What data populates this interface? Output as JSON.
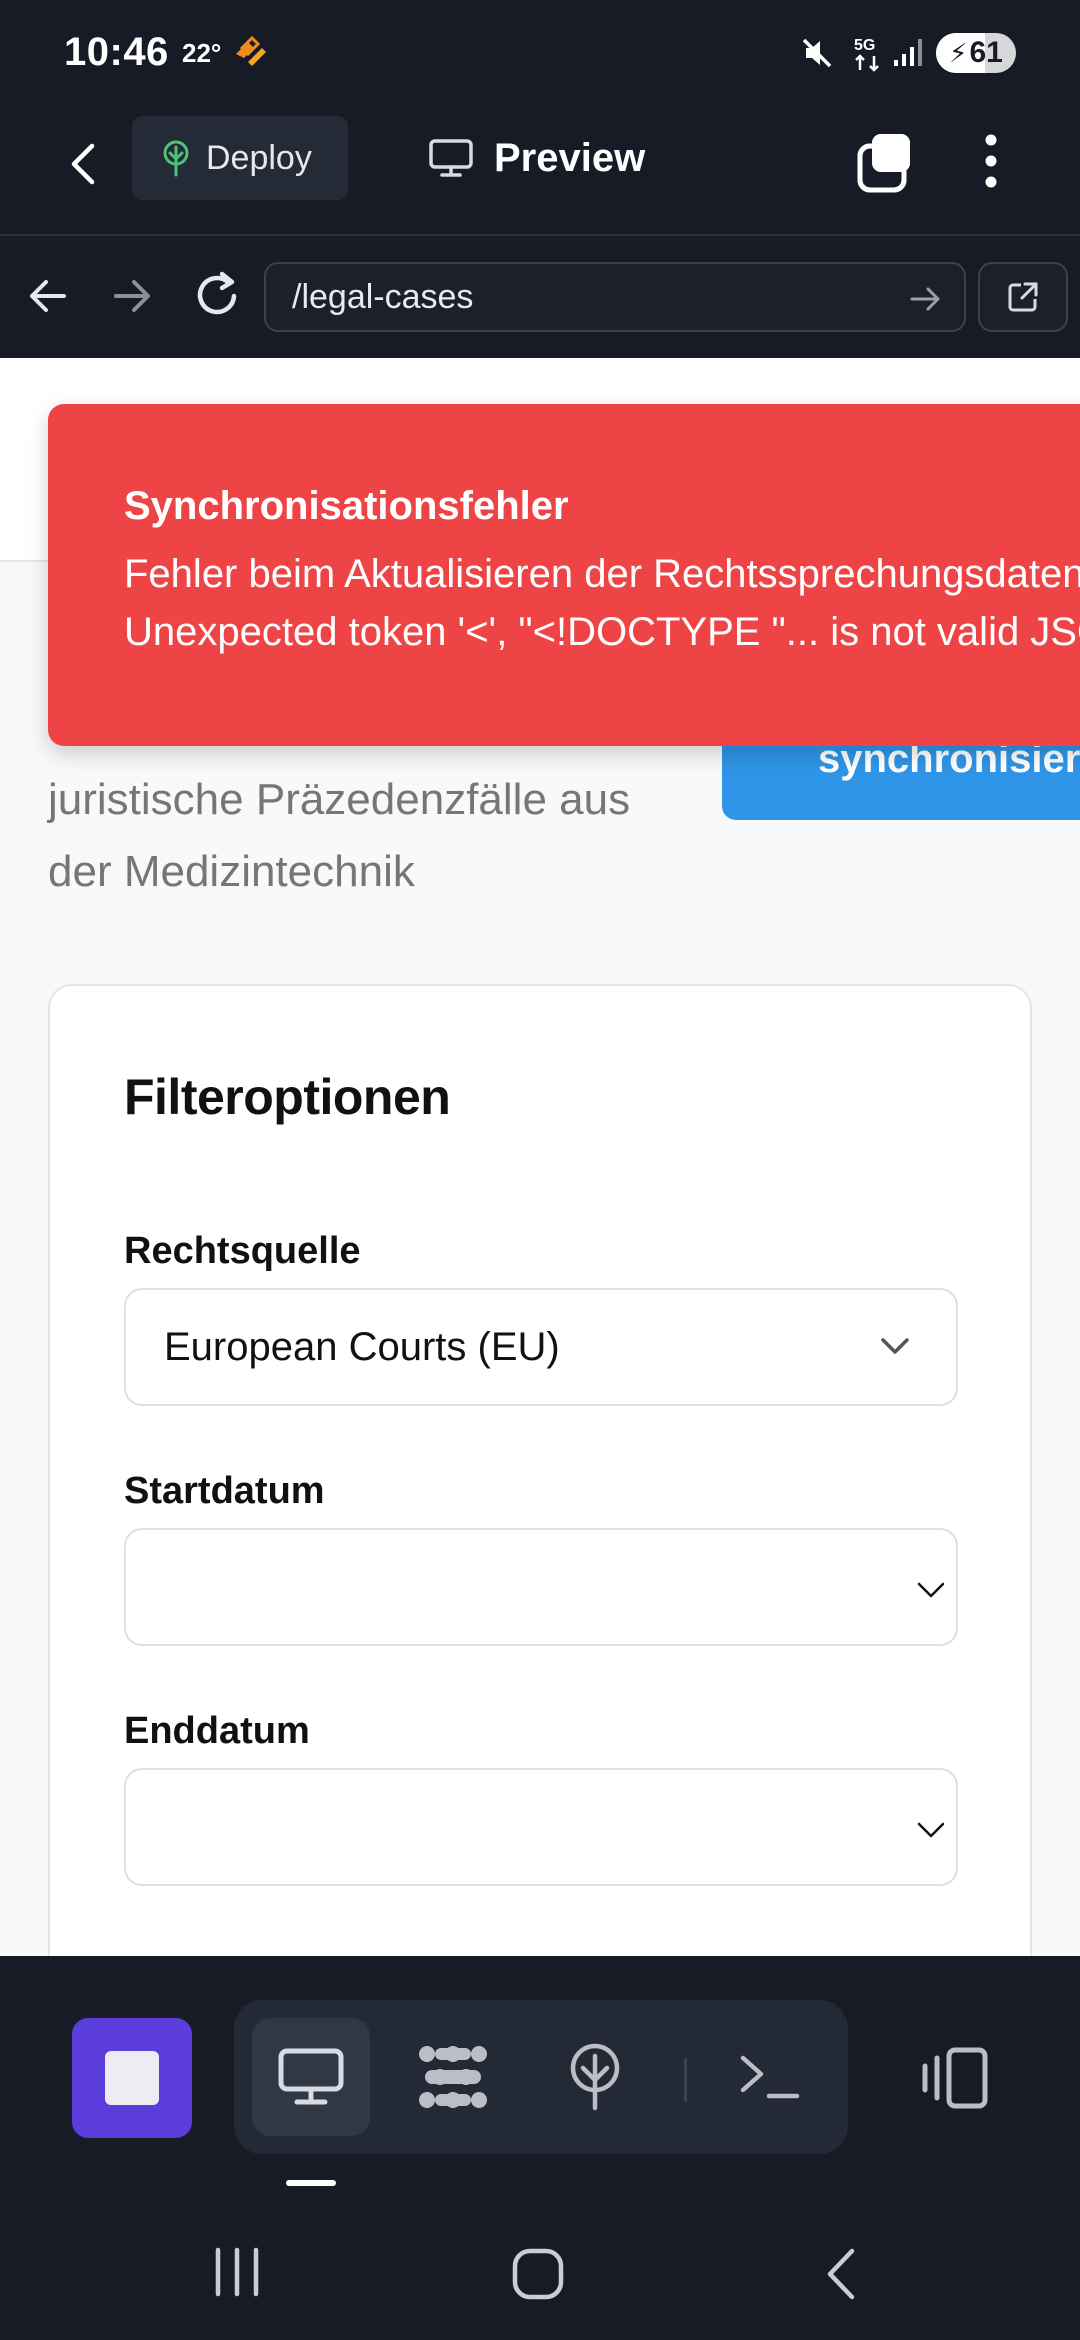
{
  "status_bar": {
    "time": "10:46",
    "temperature": "22°",
    "network": "5G",
    "battery_percent": "61",
    "battery_level": 0.61,
    "icons": [
      "weather-icon",
      "mute-icon",
      "network-5g-icon",
      "signal-icon",
      "battery-charging-icon"
    ]
  },
  "app_bar": {
    "deploy_label": "Deploy",
    "preview_label": "Preview",
    "icons": [
      "back-icon",
      "deploy-tree-icon",
      "monitor-icon",
      "tabs-icon",
      "more-vert-icon"
    ]
  },
  "browser": {
    "url": "/legal-cases",
    "icons": [
      "nav-back-icon",
      "nav-forward-icon",
      "reload-icon",
      "go-arrow-icon",
      "open-external-icon"
    ]
  },
  "page": {
    "subtitle_lines": [
      "juristische Präzedenzfälle aus",
      "der Medizintechnik"
    ],
    "sync_button_label": "Daten synchronisieren"
  },
  "error_toast": {
    "title": "Synchronisationsfehler",
    "line1": "Fehler beim Aktualisieren der Rechtssprechungsdaten:",
    "line2": "Unexpected token '<', \"<!DOCTYPE \"... is not valid JSON"
  },
  "filters": {
    "heading": "Filteroptionen",
    "source_label": "Rechtsquelle",
    "source_value": "European Courts (EU)",
    "start_label": "Startdatum",
    "start_value": "",
    "end_label": "Enddatum",
    "end_value": ""
  },
  "toolbar": {
    "icons": [
      "stop-icon",
      "monitor-icon",
      "extensions-icon",
      "deploy-icon",
      "terminal-icon",
      "layout-toggle-icon"
    ],
    "accent": "#5a3ddb"
  },
  "colors": {
    "background": "#161b26",
    "error": "#ef4446",
    "primary": "#2f95e8"
  }
}
